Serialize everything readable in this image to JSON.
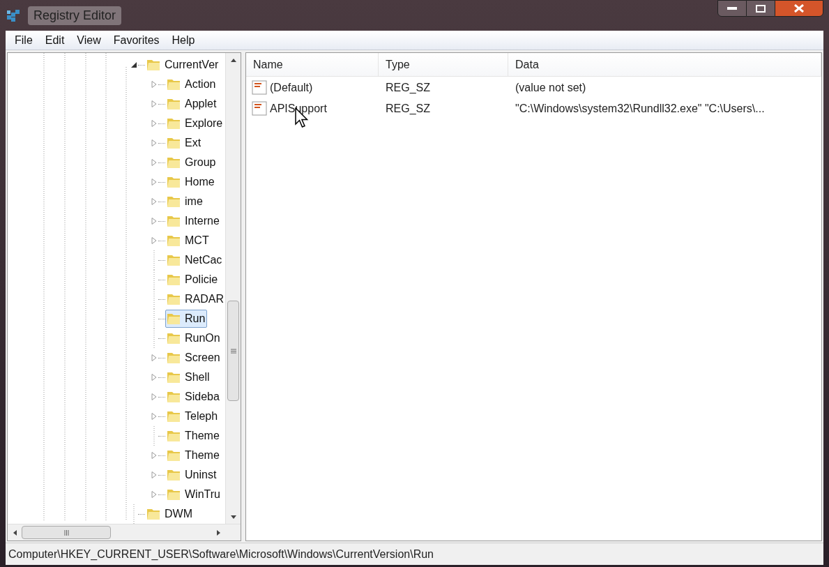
{
  "window": {
    "title": "Registry Editor"
  },
  "menu": [
    "File",
    "Edit",
    "View",
    "Favorites",
    "Help"
  ],
  "tree": [
    {
      "label": "CurrentVer",
      "expandable": true,
      "expanded": true,
      "selected": false,
      "children": [
        {
          "label": "Action",
          "expandable": true,
          "expanded": false,
          "selected": false
        },
        {
          "label": "Applet",
          "expandable": true,
          "expanded": false,
          "selected": false
        },
        {
          "label": "Explore",
          "expandable": true,
          "expanded": false,
          "selected": false
        },
        {
          "label": "Ext",
          "expandable": true,
          "expanded": false,
          "selected": false
        },
        {
          "label": "Group",
          "expandable": true,
          "expanded": false,
          "selected": false
        },
        {
          "label": "Home",
          "expandable": true,
          "expanded": false,
          "selected": false
        },
        {
          "label": "ime",
          "expandable": true,
          "expanded": false,
          "selected": false
        },
        {
          "label": "Interne",
          "expandable": true,
          "expanded": false,
          "selected": false
        },
        {
          "label": "MCT",
          "expandable": true,
          "expanded": false,
          "selected": false
        },
        {
          "label": "NetCac",
          "expandable": false,
          "selected": false
        },
        {
          "label": "Policie",
          "expandable": false,
          "selected": false
        },
        {
          "label": "RADAR",
          "expandable": false,
          "selected": false
        },
        {
          "label": "Run",
          "expandable": false,
          "selected": true
        },
        {
          "label": "RunOn",
          "expandable": false,
          "selected": false
        },
        {
          "label": "Screen",
          "expandable": true,
          "expanded": false,
          "selected": false
        },
        {
          "label": "Shell",
          "expandable": true,
          "expanded": false,
          "selected": false
        },
        {
          "label": "Sideba",
          "expandable": true,
          "expanded": false,
          "selected": false
        },
        {
          "label": "Teleph",
          "expandable": true,
          "expanded": false,
          "selected": false
        },
        {
          "label": "Theme",
          "expandable": false,
          "selected": false
        },
        {
          "label": "Theme",
          "expandable": true,
          "expanded": false,
          "selected": false
        },
        {
          "label": "Uninst",
          "expandable": true,
          "expanded": false,
          "selected": false
        },
        {
          "label": "WinTru",
          "expandable": true,
          "expanded": false,
          "selected": false
        }
      ]
    },
    {
      "label": "DWM",
      "expandable": false,
      "selected": false
    }
  ],
  "table": {
    "columns": [
      "Name",
      "Type",
      "Data"
    ],
    "rows": [
      {
        "name": "(Default)",
        "type": "REG_SZ",
        "data": "(value not set)"
      },
      {
        "name": "APISupport",
        "type": "REG_SZ",
        "data": "\"C:\\Windows\\system32\\Rundll32.exe\" \"C:\\Users\\..."
      }
    ]
  },
  "status_bar": "Computer\\HKEY_CURRENT_USER\\Software\\Microsoft\\Windows\\CurrentVersion\\Run"
}
